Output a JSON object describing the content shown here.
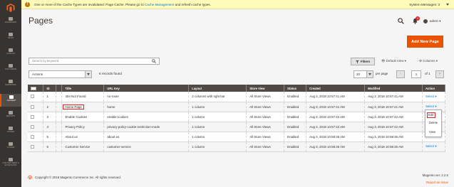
{
  "notice": {
    "text_before": "One or more of the Cache Types are invalidated: Page Cache. Please go to ",
    "link": "Cache Management",
    "text_after": " and refresh cache types.",
    "system_messages": "System Messages: 3"
  },
  "sidebar": [
    {
      "label": "DASHBOARD",
      "active": false
    },
    {
      "label": "SALES",
      "active": false
    },
    {
      "label": "CATALOG",
      "active": false
    },
    {
      "label": "CUSTOMERS",
      "active": false
    },
    {
      "label": "MARKETING",
      "active": false
    },
    {
      "label": "CONTENT",
      "active": true
    },
    {
      "label": "REPORTS",
      "active": false
    },
    {
      "label": "STORES",
      "active": false
    },
    {
      "label": "SYSTEM",
      "active": false
    },
    {
      "label": "FIND PARTNERS & EXTENSIONS",
      "active": false
    }
  ],
  "page": {
    "title": "Pages",
    "add_button": "Add New Page",
    "user": "admin",
    "notifications": "3"
  },
  "toolbar": {
    "search_placeholder": "Search by keyword",
    "filters": "Filters",
    "default_view": "Default View",
    "columns": "Columns",
    "actions": "Actions",
    "records_found": "6 records found",
    "per_page_value": "20",
    "per_page_label": "per page",
    "page_current": "1",
    "page_of": "of 1"
  },
  "table": {
    "headers": [
      "",
      "ID",
      "",
      "Title",
      "URL Key",
      "Layout",
      "Store View",
      "Status",
      "Created",
      "Modified",
      "Action"
    ],
    "rows": [
      {
        "id": "1",
        "title": "404 Not Found",
        "url_key": "no-route",
        "layout": "2 columns with right bar",
        "store": "All Store Views",
        "status": "Enabled",
        "created": "Aug 3, 2018 10:57:41 AM",
        "modified": "Aug 3, 2018 10:57:41 AM",
        "action": "Select"
      },
      {
        "id": "2",
        "title": "Home Page",
        "url_key": "home",
        "layout": "1 column",
        "store": "All Store Views",
        "status": "Enabled",
        "created": "Aug 3, 2018 10:57:41 AM",
        "modified": "Aug 3, 2018 10:57:41 AM",
        "action": "Select"
      },
      {
        "id": "3",
        "title": "Enable Cookies",
        "url_key": "enable-cookies",
        "layout": "1 column",
        "store": "All Store Views",
        "status": "Enabled",
        "created": "Aug 3, 2018 10:57:42 AM",
        "modified": "Aug 3, 2018 10:57:42 AM",
        "action": "Select"
      },
      {
        "id": "4",
        "title": "Privacy Policy",
        "url_key": "privacy-policy-cookie-restriction-mode",
        "layout": "1 column",
        "store": "All Store Views",
        "status": "Enabled",
        "created": "Aug 3, 2018 10:57:42 AM",
        "modified": "Aug 3, 2018 10:57:42 AM",
        "action": "Select"
      },
      {
        "id": "5",
        "title": "About us",
        "url_key": "about-us",
        "layout": "1 column",
        "store": "All Store Views",
        "status": "Enabled",
        "created": "Aug 3, 2018 10:58:36 AM",
        "modified": "Aug 3, 2018 10:58:36 AM",
        "action": "Select"
      },
      {
        "id": "6",
        "title": "Customer Service",
        "url_key": "customer-service",
        "layout": "1 column",
        "store": "All Store Views",
        "status": "Enabled",
        "created": "Aug 3, 2018 10:58:36 AM",
        "modified": "Aug 3, 2018 10:58:36 AM",
        "action": "Select"
      }
    ]
  },
  "action_menu": {
    "edit": "Edit",
    "delete": "Delete",
    "view": "View"
  },
  "footer": {
    "copyright": "Copyright © 2018 Magento Commerce Inc. All rights reserved.",
    "version": "Magento ver. 2.2.5",
    "report": "Report an Issue"
  },
  "colors": {
    "accent": "#eb5202",
    "sidebar": "#373330",
    "header_row": "#514943",
    "link": "#007bdb"
  }
}
